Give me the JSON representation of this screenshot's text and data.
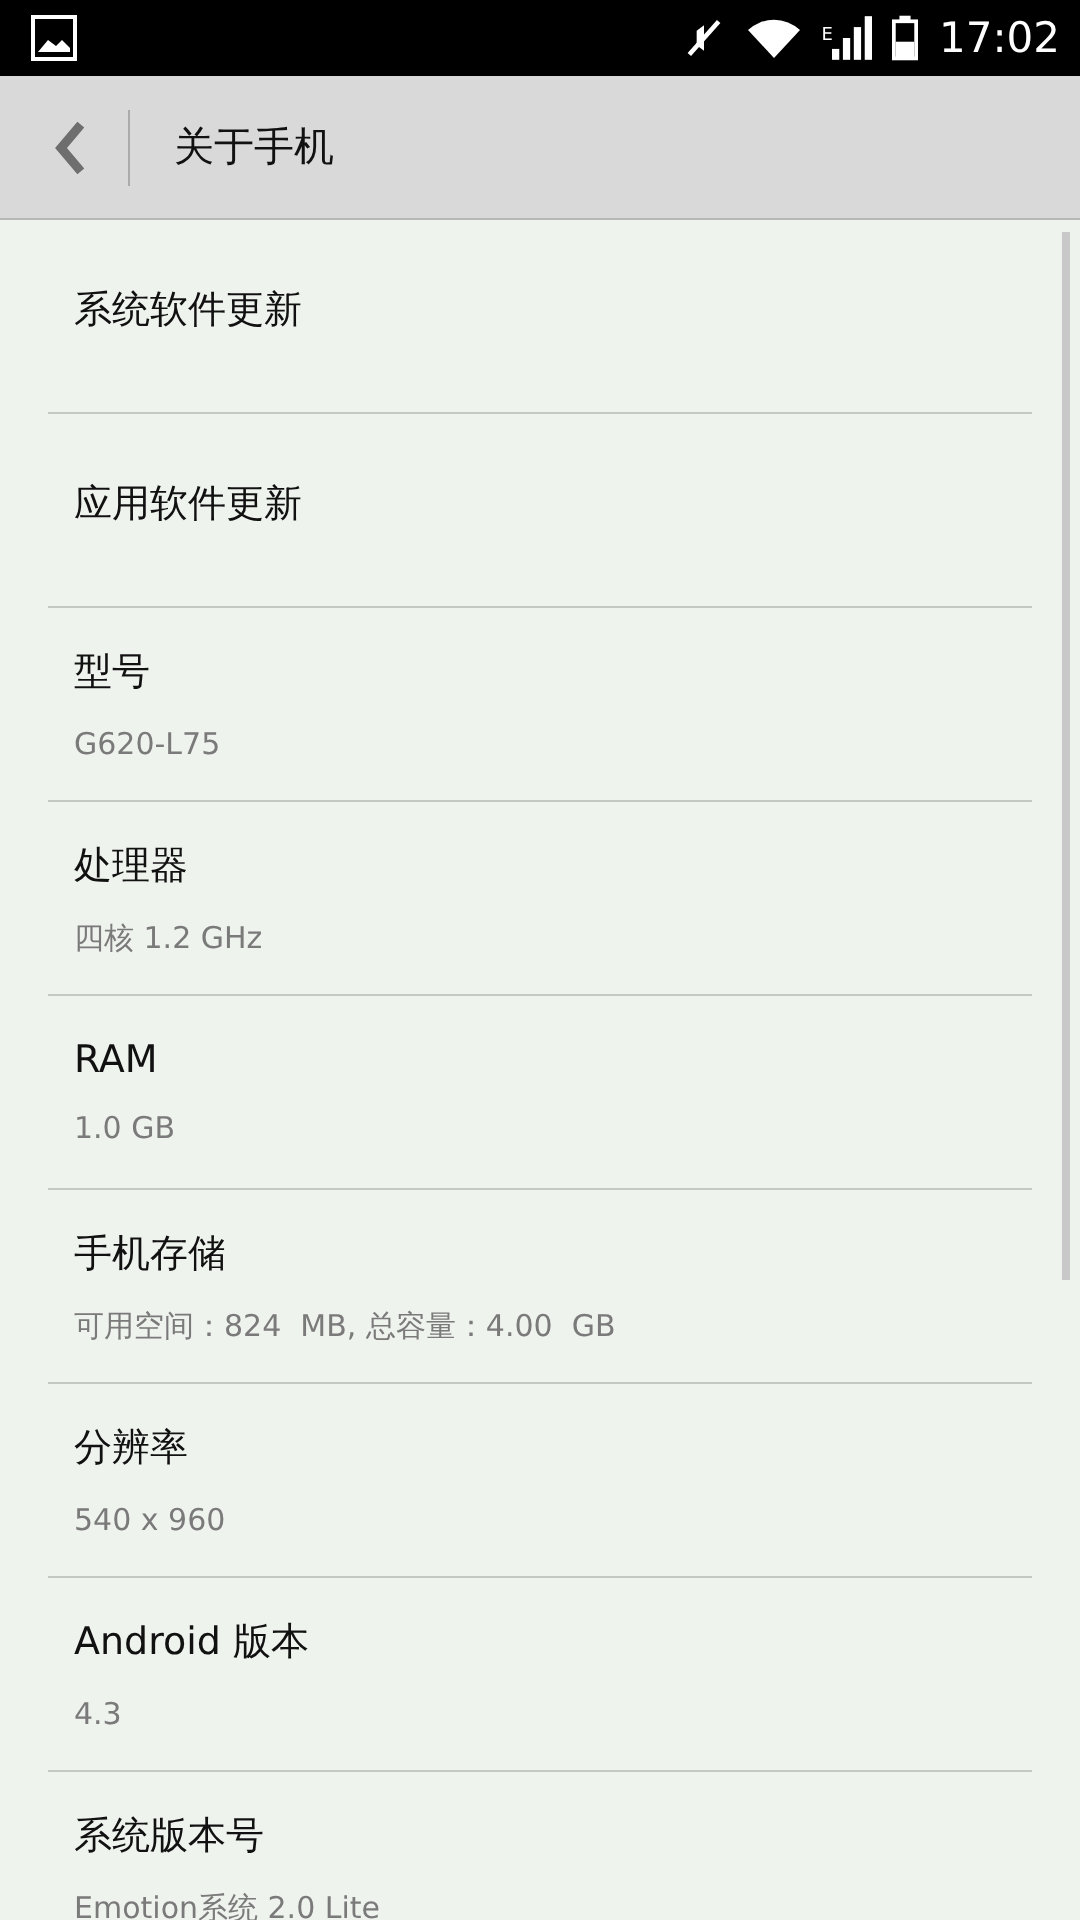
{
  "status_bar": {
    "time": "17:02",
    "network_type": "E"
  },
  "action_bar": {
    "title": "关于手机"
  },
  "items": [
    {
      "title": "系统软件更新"
    },
    {
      "title": "应用软件更新"
    },
    {
      "title": "型号",
      "summary": "G620-L75"
    },
    {
      "title": "处理器",
      "summary": "四核 1.2 GHz"
    },
    {
      "title": "RAM",
      "summary": "1.0 GB"
    },
    {
      "title": "手机存储",
      "summary": "可用空间：824  MB, 总容量：4.00  GB"
    },
    {
      "title": "分辨率",
      "summary": "540 x 960"
    },
    {
      "title": "Android 版本",
      "summary": "4.3"
    },
    {
      "title": "系统版本号",
      "summary": "Emotion系统 2.0 Lite"
    }
  ]
}
